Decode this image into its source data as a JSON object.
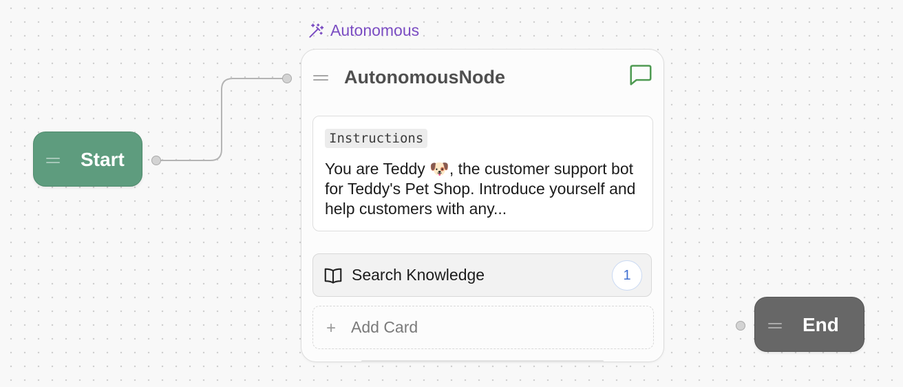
{
  "nodes": {
    "start": {
      "label": "Start",
      "color": "#5e9c7e"
    },
    "end": {
      "label": "End",
      "color": "#676767"
    },
    "autonomous": {
      "tag": "Autonomous",
      "tag_color": "#7a4cc2",
      "title": "AutonomousNode",
      "header_icon": "chat-bubble-icon",
      "instructions": {
        "tag": "Instructions",
        "text": "You are Teddy 🐶, the customer support bot for Teddy's Pet Shop. Introduce yourself and help customers with any..."
      },
      "cards": [
        {
          "icon": "book-open-icon",
          "label": "Search Knowledge",
          "count": "1"
        }
      ],
      "add_card_label": "Add Card"
    }
  }
}
